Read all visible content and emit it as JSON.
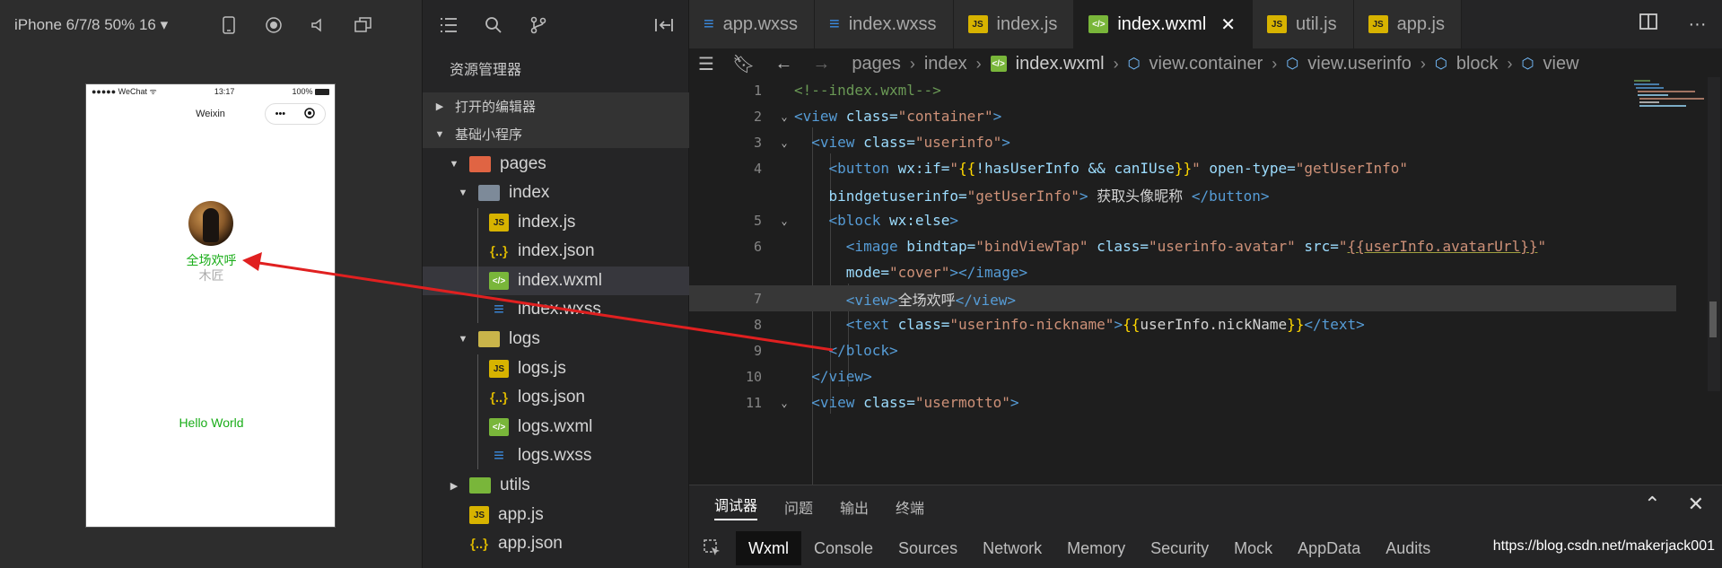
{
  "simulator": {
    "device_label": "iPhone 6/7/8 50% 16 ▾",
    "status_carrier": "●●●●● WeChat ᯤ",
    "status_time": "13:17",
    "status_battery": "100%",
    "nav_title": "Weixin",
    "capsule_more": "•••",
    "welcome_text": "全场欢呼",
    "nickname_text": "木匠",
    "motto_text": "Hello World"
  },
  "explorer": {
    "title": "资源管理器",
    "sections": {
      "open_editors": "打开的编辑器",
      "project": "基础小程序"
    },
    "tree": {
      "pages": "pages",
      "index": "index",
      "index_js": "index.js",
      "index_json": "index.json",
      "index_wxml": "index.wxml",
      "index_wxss": "index.wxss",
      "logs": "logs",
      "logs_js": "logs.js",
      "logs_json": "logs.json",
      "logs_wxml": "logs.wxml",
      "logs_wxss": "logs.wxss",
      "utils": "utils",
      "app_js": "app.js",
      "app_json": "app.json"
    }
  },
  "editor": {
    "tabs": {
      "app_wxss": "app.wxss",
      "index_wxss": "index.wxss",
      "index_js": "index.js",
      "index_wxml": "index.wxml",
      "util_js": "util.js",
      "app_js": "app.js"
    },
    "breadcrumbs": {
      "pages": "pages",
      "index": "index",
      "file": "index.wxml",
      "container": "view.container",
      "userinfo": "view.userinfo",
      "block": "block",
      "view": "view"
    },
    "line_numbers": [
      "1",
      "2",
      "3",
      "4",
      "5",
      "6",
      "7",
      "8",
      "9",
      "10",
      "11"
    ],
    "code": {
      "l1_comment": "<!--index.wxml-->",
      "l2_open": "<view",
      "l2_attr": " class=",
      "l2_val": "\"container\"",
      "l2_close": ">",
      "l3_open": "<view",
      "l3_attr": " class=",
      "l3_val": "\"userinfo\"",
      "l3_close": ">",
      "l4_open": "<button",
      "l4_attr1": " wx:if=",
      "l4_q1": "\"",
      "l4_b1": "{{",
      "l4_expr": "!hasUserInfo && canIUse",
      "l4_b2": "}}",
      "l4_q2": "\"",
      "l4_attr2": " open-type=",
      "l4_val2": "\"getUserInfo\"",
      "l4b_attr": "bindgetuserinfo=",
      "l4b_val": "\"getUserInfo\"",
      "l4b_close": ">",
      "l4b_text": " 获取头像昵称 ",
      "l4b_end": "</button>",
      "l5_open": "<block",
      "l5_attr": " wx:else",
      "l5_close": ">",
      "l6_open": "<image",
      "l6_attr1": " bindtap=",
      "l6_val1": "\"bindViewTap\"",
      "l6_attr2": " class=",
      "l6_val2": "\"userinfo-avatar\"",
      "l6_attr3": " src=",
      "l6_q1": "\"",
      "l6_url": "{{userInfo.avatarUrl}}",
      "l6_q2": "\"",
      "l6b_attr": "mode=",
      "l6b_val": "\"cover\"",
      "l6b_close": "></image>",
      "l7_open": "<view>",
      "l7_text": "全场欢呼",
      "l7_close": "</view>",
      "l8_open": "<text",
      "l8_attr": " class=",
      "l8_val": "\"userinfo-nickname\"",
      "l8_gt": ">",
      "l8_b1": "{{",
      "l8_expr": "userInfo.nickName",
      "l8_b2": "}}",
      "l8_close": "</text>",
      "l9_close": "</block>",
      "l10_close": "</view>",
      "l11_open": "<view",
      "l11_attr": " class=",
      "l11_val": "\"usermotto\"",
      "l11_close": ">"
    }
  },
  "debug": {
    "panel_tabs": [
      "调试器",
      "问题",
      "输出",
      "终端"
    ],
    "devtools_tabs": [
      "Wxml",
      "Console",
      "Sources",
      "Network",
      "Memory",
      "Security",
      "Mock",
      "AppData",
      "Audits"
    ],
    "watermark": "https://blog.csdn.net/makerjack001"
  },
  "colors": {
    "accent_green": "#1aad19",
    "annotation_arrow": "#e02020"
  }
}
